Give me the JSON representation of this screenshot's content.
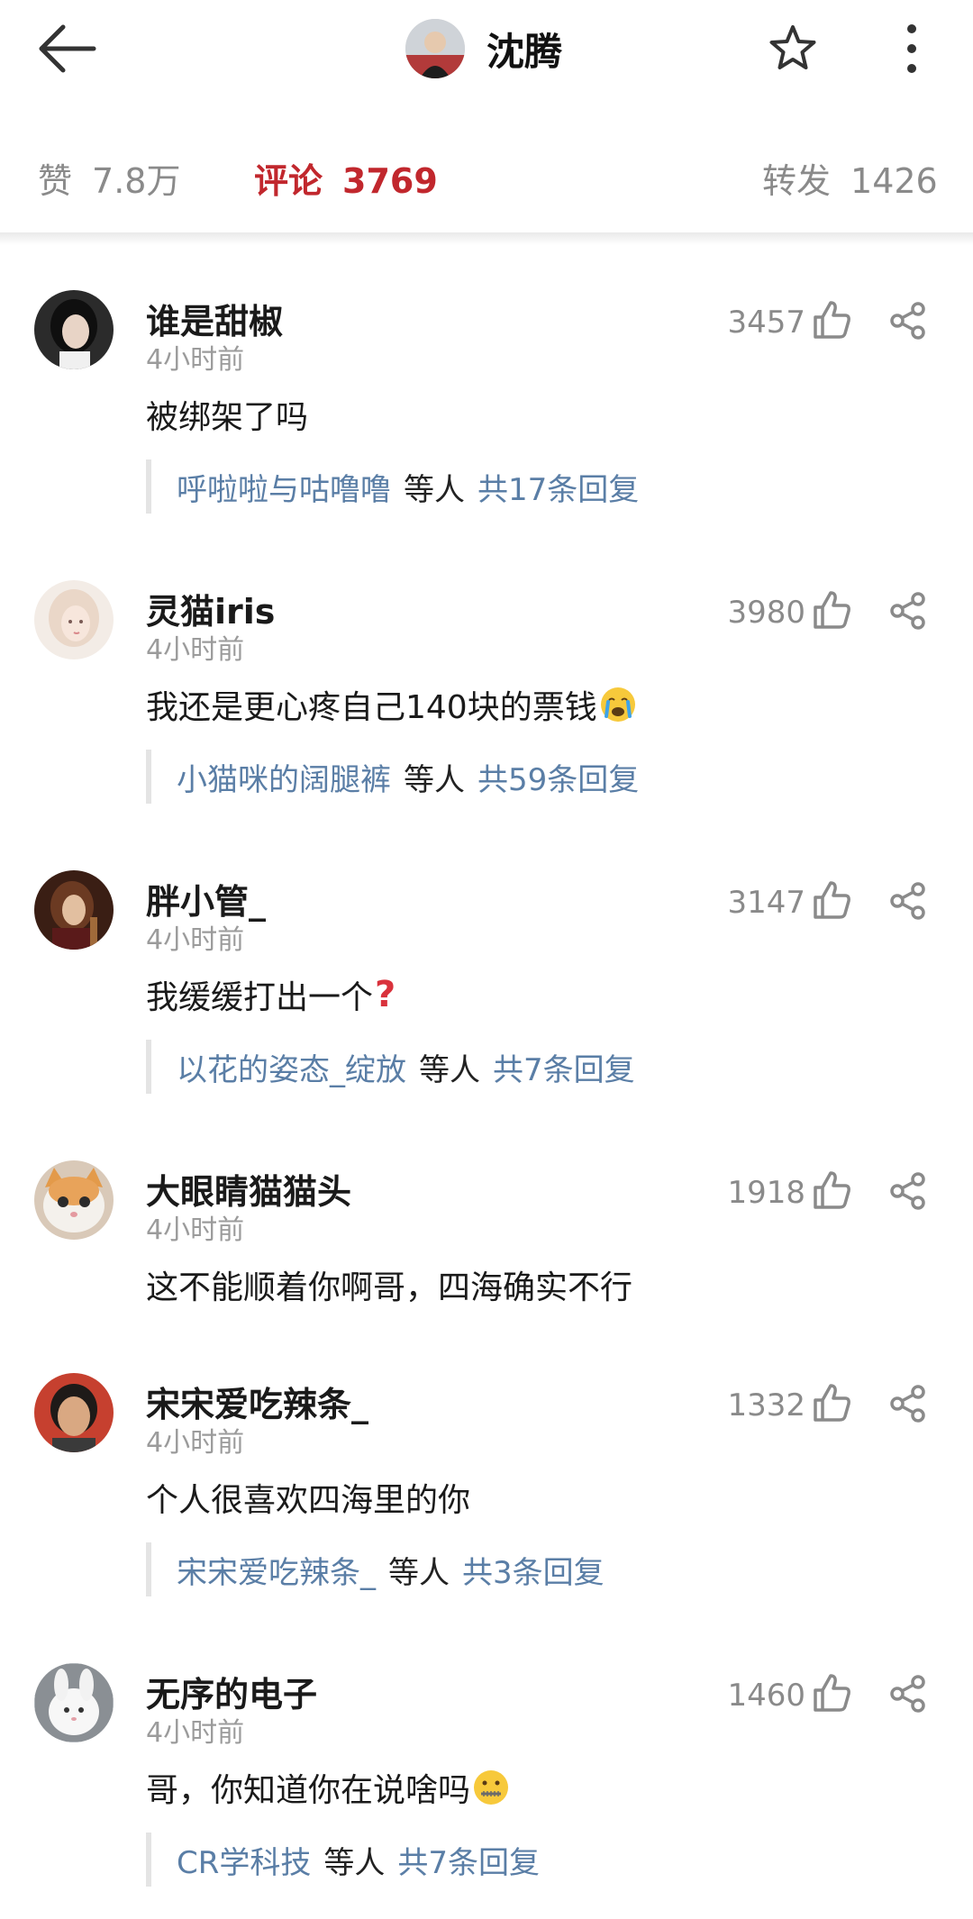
{
  "header": {
    "title": "沈腾"
  },
  "stats": {
    "likes_label": "赞",
    "likes_value": "7.8万",
    "comments_label": "评论",
    "comments_value": "3769",
    "reposts_label": "转发",
    "reposts_value": "1426"
  },
  "comments": [
    {
      "user": "谁是甜椒",
      "time": "4小时前",
      "text": "被绑架了吗",
      "likes": "3457",
      "reply_user": "呼啦啦与咕噜噜",
      "reply_mid": "等人",
      "reply_count": "共17条回复",
      "emoji": ""
    },
    {
      "user": "灵猫iris",
      "time": "4小时前",
      "text": "我还是更心疼自己140块的票钱",
      "likes": "3980",
      "reply_user": "小猫咪的阔腿裤",
      "reply_mid": "等人",
      "reply_count": "共59条回复",
      "emoji": "crying-face"
    },
    {
      "user": "胖小管_",
      "time": "4小时前",
      "text": "我缓缓打出一个",
      "likes": "3147",
      "reply_user": "以花的姿态_绽放",
      "reply_mid": "等人",
      "reply_count": "共7条回复",
      "emoji": "question-mark"
    },
    {
      "user": "大眼睛猫猫头",
      "time": "4小时前",
      "text": "这不能顺着你啊哥，四海确实不行",
      "likes": "1918",
      "reply_user": "",
      "reply_mid": "",
      "reply_count": "",
      "emoji": ""
    },
    {
      "user": "宋宋爱吃辣条_",
      "time": "4小时前",
      "text": "个人很喜欢四海里的你",
      "likes": "1332",
      "reply_user": "宋宋爱吃辣条_",
      "reply_mid": "等人",
      "reply_count": "共3条回复",
      "emoji": ""
    },
    {
      "user": "无序的电子",
      "time": "4小时前",
      "text": "哥，你知道你在说啥吗",
      "likes": "1460",
      "reply_user": "CR学科技",
      "reply_mid": "等人",
      "reply_count": "共7条回复",
      "emoji": "zipper-mouth-face"
    }
  ],
  "colors": {
    "accent": "#c1272d",
    "link": "#5a7ea6",
    "muted": "#8a8a8a"
  }
}
